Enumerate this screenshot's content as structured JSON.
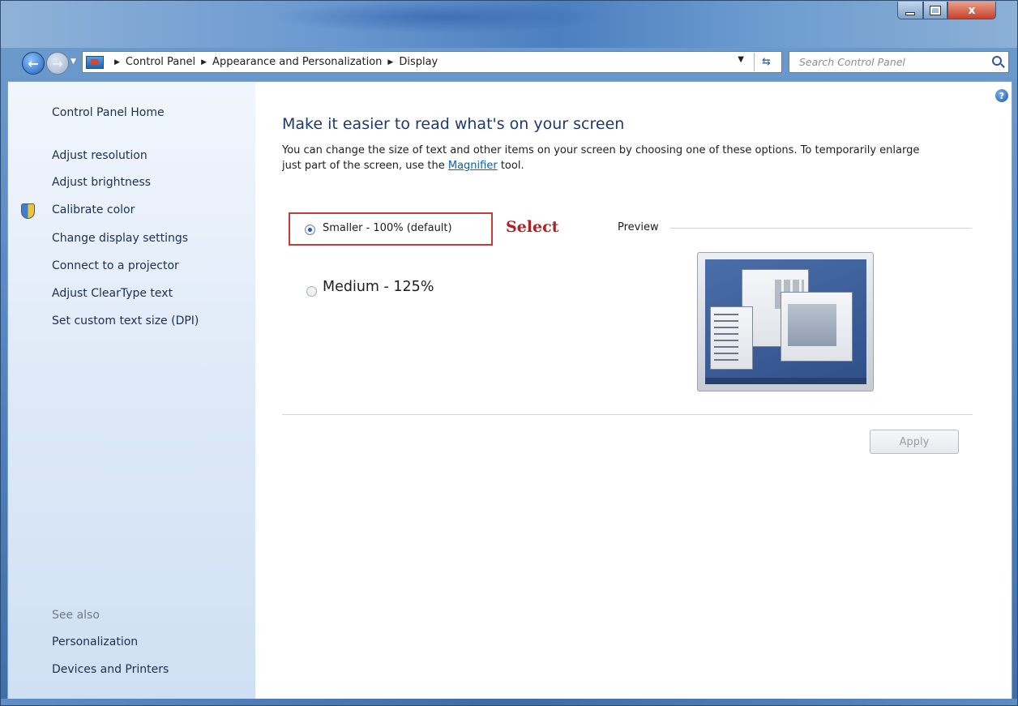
{
  "window": {
    "buttons": {
      "minimize": "",
      "maximize": "",
      "close": "x"
    }
  },
  "addressbar": {
    "breadcrumbs": [
      "Control Panel",
      "Appearance and Personalization",
      "Display"
    ],
    "search_placeholder": "Search Control Panel"
  },
  "sidebar": {
    "home": "Control Panel Home",
    "links": [
      "Adjust resolution",
      "Adjust brightness",
      "Calibrate color",
      "Change display settings",
      "Connect to a projector",
      "Adjust ClearType text",
      "Set custom text size (DPI)"
    ],
    "see_also": {
      "heading": "See also",
      "links": [
        "Personalization",
        "Devices and Printers"
      ]
    }
  },
  "main": {
    "title": "Make it easier to read what's on your screen",
    "desc_part1": "You can change the size of text and other items on your screen by choosing one of these options. To temporarily enlarge just part of the screen, use the ",
    "desc_link": "Magnifier",
    "desc_part2": " tool.",
    "options": [
      {
        "label": "Smaller - 100% (default)",
        "selected": true
      },
      {
        "label": "Medium - 125%",
        "selected": false
      }
    ],
    "annotation": "Select",
    "preview_label": "Preview",
    "apply_button": "Apply"
  },
  "icons": {
    "help": "?",
    "refresh": "⇆",
    "back": "←",
    "forward": "→"
  }
}
